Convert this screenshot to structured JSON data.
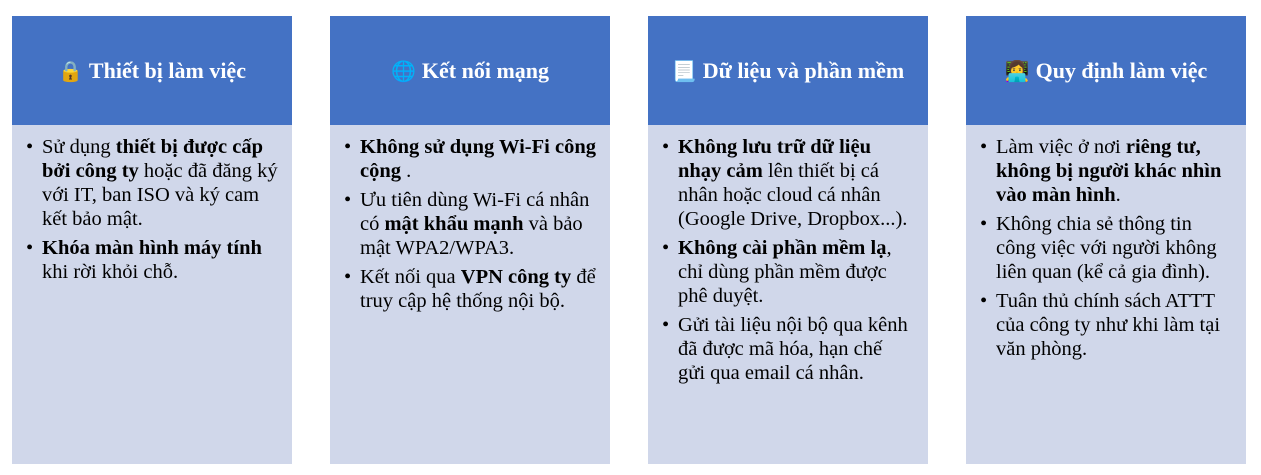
{
  "colors": {
    "header_bg": "#4472c4",
    "card_bg": "#d0d7ea",
    "header_text": "#ffffff"
  },
  "cards": [
    {
      "icon": "🔒",
      "icon_name": "lock-icon",
      "title": "Thiết bị làm việc",
      "items": [
        [
          "Sử dụng ",
          "thiết bị được cấp bởi công ty",
          " hoặc đã đăng ký với IT, ban ISO và ký cam kết bảo mật."
        ],
        [
          "",
          "Khóa màn hình máy tính",
          " khi rời khỏi chỗ."
        ]
      ]
    },
    {
      "icon": "🌐",
      "icon_name": "globe-icon",
      "title": "Kết nối mạng",
      "items": [
        [
          "",
          "Không sử dụng Wi-Fi công cộng",
          " ."
        ],
        [
          "Ưu tiên dùng Wi-Fi cá nhân có ",
          "mật khẩu mạnh",
          " và bảo mật WPA2/WPA3."
        ],
        [
          "Kết nối qua ",
          "VPN công ty",
          " để truy cập hệ thống nội bộ."
        ]
      ]
    },
    {
      "icon": "📃",
      "icon_name": "document-icon",
      "title": "Dữ liệu và phần mềm",
      "items": [
        [
          "",
          "Không lưu trữ dữ liệu nhạy cảm",
          " lên thiết bị cá nhân hoặc cloud cá nhân (Google Drive, Dropbox...)."
        ],
        [
          "",
          "Không cài phần mềm lạ",
          ", chỉ dùng phần mềm được phê duyệt."
        ],
        [
          "Gửi tài liệu nội bộ qua kênh đã được mã hóa, hạn chế gửi qua email cá nhân.",
          "",
          ""
        ]
      ]
    },
    {
      "icon": "👩‍💻",
      "icon_name": "person-laptop-icon",
      "title": "Quy định làm việc",
      "items": [
        [
          "Làm việc ở nơi ",
          "riêng tư, không bị người khác nhìn vào màn hình",
          "."
        ],
        [
          "Không chia sẻ thông tin công việc với người không liên quan (kể cả gia đình).",
          "",
          ""
        ],
        [
          "Tuân thủ chính sách ATTT của công ty như khi làm tại văn phòng.",
          "",
          ""
        ]
      ]
    }
  ]
}
